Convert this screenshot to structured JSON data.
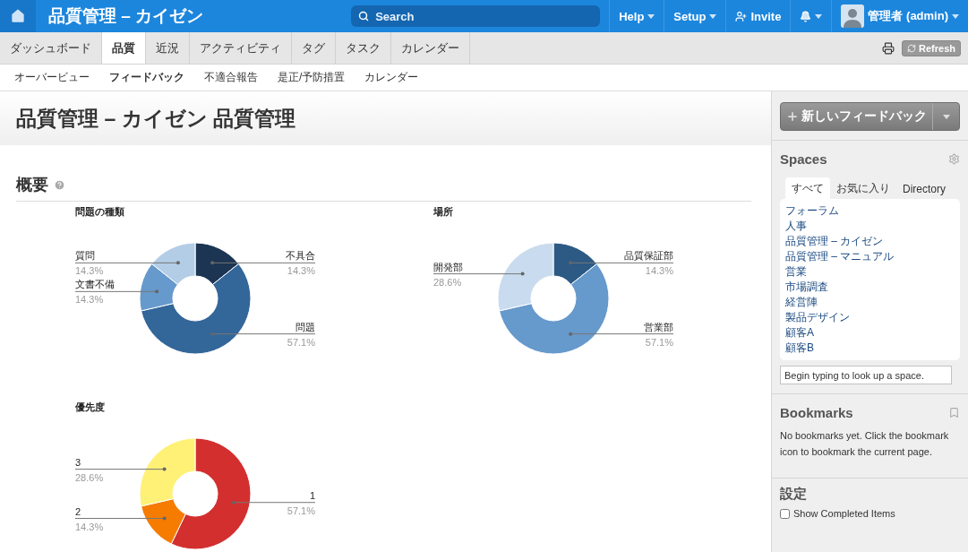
{
  "topbar": {
    "title": "品質管理 – カイゼン",
    "search": {
      "placeholder": "Search"
    },
    "menus": [
      {
        "kind": "menu",
        "label": "Help"
      },
      {
        "kind": "menu",
        "label": "Setup"
      },
      {
        "kind": "invite",
        "label": "Invite"
      },
      {
        "kind": "bell"
      },
      {
        "kind": "user",
        "label": "管理者 (admin)"
      }
    ]
  },
  "tabs": [
    {
      "label": "ダッシュボード",
      "selected": false
    },
    {
      "label": "品質",
      "selected": true
    },
    {
      "label": "近況",
      "selected": false
    },
    {
      "label": "アクティビティ",
      "selected": false
    },
    {
      "label": "タグ",
      "selected": false
    },
    {
      "label": "タスク",
      "selected": false
    },
    {
      "label": "カレンダー",
      "selected": false
    }
  ],
  "refresh_button": "Refresh",
  "subnav": [
    {
      "label": "オーバービュー",
      "selected": false
    },
    {
      "label": "フィードバック",
      "selected": true
    },
    {
      "label": "不適合報告",
      "selected": false
    },
    {
      "label": "是正/予防措置",
      "selected": false
    },
    {
      "label": "カレンダー",
      "selected": false
    }
  ],
  "page_title": "品質管理 – カイゼン 品質管理",
  "section_title": "概要",
  "charts": [
    {
      "chart_data": {
        "type": "donut",
        "title": "問題の種類",
        "categories": [
          "不具合",
          "問題",
          "文書不備",
          "質問"
        ],
        "values": [
          14.3,
          57.1,
          14.3,
          14.3
        ],
        "colors": [
          "#1b3553",
          "#336699",
          "#6699cc",
          "#b3cde6"
        ],
        "value_labels": [
          "14.3%",
          "57.1%",
          "14.3%",
          "14.3%"
        ]
      }
    },
    {
      "chart_data": {
        "type": "donut",
        "title": "場所",
        "categories": [
          "品質保証部",
          "営業部",
          "開発部"
        ],
        "values": [
          14.3,
          57.1,
          28.6
        ],
        "colors": [
          "#2d5985",
          "#6699cc",
          "#c9dbee"
        ],
        "value_labels": [
          "14.3%",
          "57.1%",
          "28.6%"
        ]
      }
    },
    {
      "chart_data": {
        "type": "donut",
        "title": "優先度",
        "categories": [
          "1",
          "2",
          "3"
        ],
        "values": [
          57.1,
          14.3,
          28.6
        ],
        "colors": [
          "#d32f2f",
          "#f57c00",
          "#fff176"
        ],
        "value_labels": [
          "57.1%",
          "14.3%",
          "28.6%"
        ]
      }
    }
  ],
  "sidebar": {
    "new_button": "新しいフィードバック",
    "spaces": {
      "title": "Spaces",
      "tabs": [
        {
          "label": "すべて",
          "selected": true
        },
        {
          "label": "お気に入り",
          "selected": false
        },
        {
          "label": "Directory",
          "selected": false
        }
      ],
      "items": [
        "フォーラム",
        "人事",
        "品質管理 – カイゼン",
        "品質管理 – マニュアル",
        "営業",
        "市場調査",
        "経営陣",
        "製品デザイン",
        "顧客A",
        "顧客B"
      ],
      "lookup": {
        "placeholder": "Begin typing to look up a space."
      }
    },
    "bookmarks": {
      "title": "Bookmarks",
      "text": "No bookmarks yet. Click the bookmark icon to bookmark the current page."
    },
    "settings": {
      "title": "設定",
      "options": [
        {
          "label": "Show Completed Items",
          "checked": false
        }
      ]
    }
  }
}
